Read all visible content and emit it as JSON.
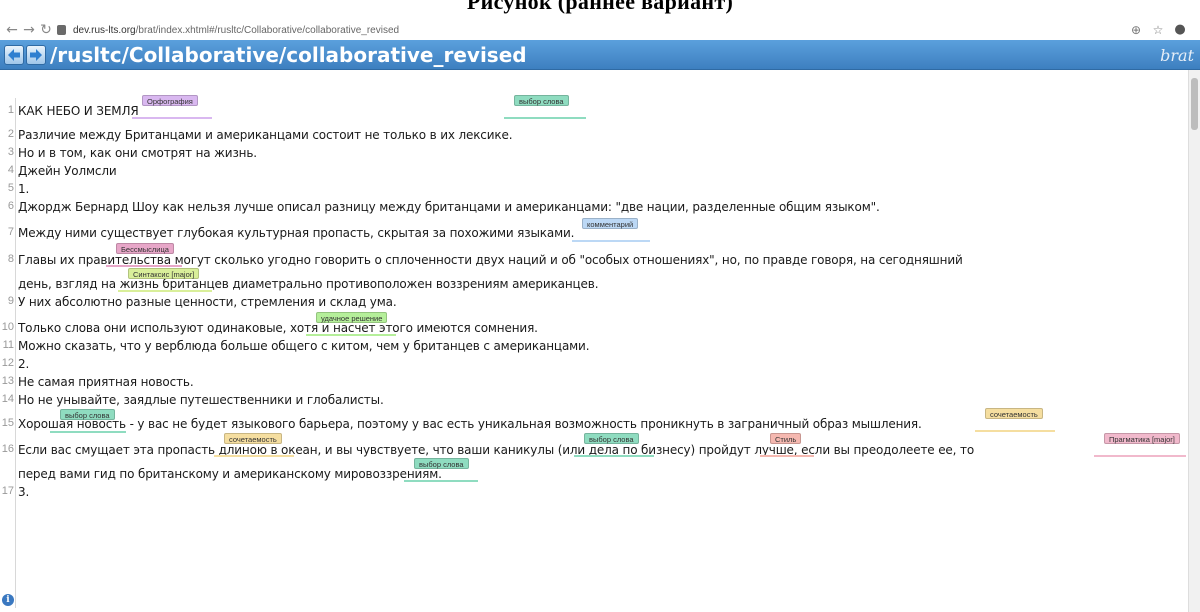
{
  "caption": "Рисунок (раннее вариант)",
  "browser": {
    "url_host": "dev.rus-lts.org",
    "url_path": "/brat/index.xhtml#/rusltc/Collaborative/collaborative_revised"
  },
  "header": {
    "document_path": "/rusltc/Collaborative/collaborative_revised",
    "logo": "brat"
  },
  "colors": {
    "header_top": "#5ba0dd",
    "header_bottom": "#3d7fc0",
    "ann_orthography": "#d9b8f0",
    "ann_word_choice": "#8fdcc0",
    "ann_comment": "#bcd8f5",
    "ann_nonsense": "#e7a6c8",
    "ann_syntax": "#d9ef9a",
    "ann_good": "#b5ef9a",
    "ann_combinability": "#f5dea0",
    "ann_style": "#f5b8b0",
    "ann_pragmatics": "#f1b9cc"
  },
  "lines": [
    {
      "n": "1",
      "text": "КАК НЕБО И ЗЕМЛЯ"
    },
    {
      "n": "2",
      "text": "Различие между Британцами и американцами состоит не только в их лексике."
    },
    {
      "n": "3",
      "text": "Но и в том, как они смотрят на жизнь."
    },
    {
      "n": "4",
      "text": "Джейн Уолмсли"
    },
    {
      "n": "5",
      "text": "1."
    },
    {
      "n": "6",
      "text": "Джордж Бернард Шоу как нельзя лучше описал разницу между британцами и американцами: \"две нации, разделенные общим языком\"."
    },
    {
      "n": "7",
      "text": "Между ними существует глубокая культурная пропасть, скрытая за похожими языками."
    },
    {
      "n": "8",
      "text": "Главы их правительства могут сколько угодно говорить о сплоченности двух наций и об \"особых отношениях\", но, по правде говоря, на сегодняшний"
    },
    {
      "n": "",
      "text": "день, взгляд на жизнь британцев диаметрально противоположен воззрениям американцев."
    },
    {
      "n": "9",
      "text": "У них абсолютно разные ценности, стремления и склад ума."
    },
    {
      "n": "10",
      "text": "Только слова они используют одинаковые, хотя и насчет этого имеются сомнения."
    },
    {
      "n": "11",
      "text": "Можно сказать, что у верблюда больше общего с китом, чем у британцев с американцами."
    },
    {
      "n": "12",
      "text": "2."
    },
    {
      "n": "13",
      "text": "Не самая приятная новость."
    },
    {
      "n": "14",
      "text": "Но не унывайте, заядлые путешественники и глобалисты."
    },
    {
      "n": "15",
      "text": "Хорошая новость - у вас не будет языкового барьера, поэтому у вас есть уникальная возможность проникнуть в заграничный образ мышления."
    },
    {
      "n": "16",
      "text": "Если вас смущает эта пропасть длиною в океан, и вы чувствуете, что ваши каникулы  (или дела по бизнесу) пройдут лучше, если вы преодолеете ее, то"
    },
    {
      "n": "",
      "text": "перед вами гид по британскому и американскому мировоззрениям."
    },
    {
      "n": "17",
      "text": "3."
    }
  ],
  "annotations": [
    {
      "label": "Орфография",
      "type": "orthography"
    },
    {
      "label": "выбор слова",
      "type": "word_choice"
    },
    {
      "label": "комментарий",
      "type": "comment"
    },
    {
      "label": "Бессмыслица",
      "type": "nonsense"
    },
    {
      "label": "Синтаксис [major]",
      "type": "syntax"
    },
    {
      "label": "удачное решение",
      "type": "good"
    },
    {
      "label": "выбор слова",
      "type": "word_choice"
    },
    {
      "label": "сочетаемость",
      "type": "combinability"
    },
    {
      "label": "сочетаемость",
      "type": "combinability"
    },
    {
      "label": "выбор слова",
      "type": "word_choice"
    },
    {
      "label": "Стиль",
      "type": "style"
    },
    {
      "label": "Прагматика [major]",
      "type": "pragmatics"
    },
    {
      "label": "выбор слова",
      "type": "word_choice"
    }
  ]
}
